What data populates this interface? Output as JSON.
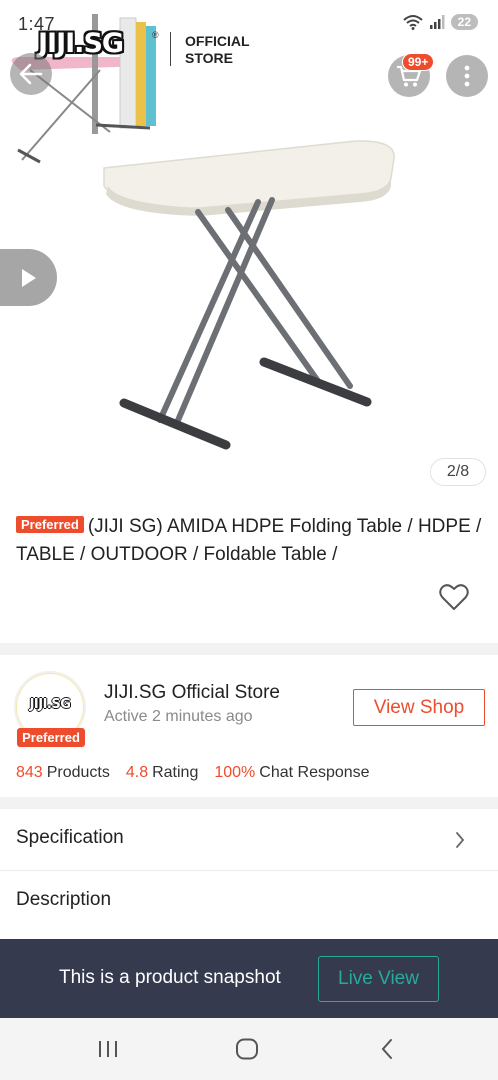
{
  "status_bar": {
    "time": "1:47",
    "battery": "22"
  },
  "brand": {
    "logo_text": "JIJI.SG",
    "registered": "®",
    "tag_line1": "OFFICIAL",
    "tag_line2": "STORE"
  },
  "header": {
    "cart_badge": "99+"
  },
  "gallery": {
    "counter": "2/8"
  },
  "product": {
    "badge": "Preferred",
    "title": "(JIJI SG) AMIDA HDPE Folding Table / HDPE / TABLE / OUTDOOR / Foldable Table /"
  },
  "shop": {
    "avatar_logo": "JIJI.SG",
    "avatar_badge": "Preferred",
    "name": "JIJI.SG Official Store",
    "active": "Active 2 minutes ago",
    "view_shop_label": "View Shop",
    "stats": [
      {
        "value": "843",
        "label": "Products"
      },
      {
        "value": "4.8",
        "label": "Rating"
      },
      {
        "value": "100%",
        "label": "Chat Response"
      }
    ]
  },
  "sections": {
    "specification": "Specification",
    "description": "Description"
  },
  "snapshot": {
    "text": "This is a product snapshot",
    "live_view_label": "Live View"
  },
  "colors": {
    "accent": "#ee4d2d",
    "teal": "#26aa99",
    "snapshot_bg": "#353a4f"
  },
  "icons": [
    "back-arrow-icon",
    "cart-icon",
    "more-vert-icon",
    "play-icon",
    "heart-icon",
    "chevron-right-icon",
    "recent-apps-icon",
    "home-icon",
    "nav-back-icon"
  ]
}
